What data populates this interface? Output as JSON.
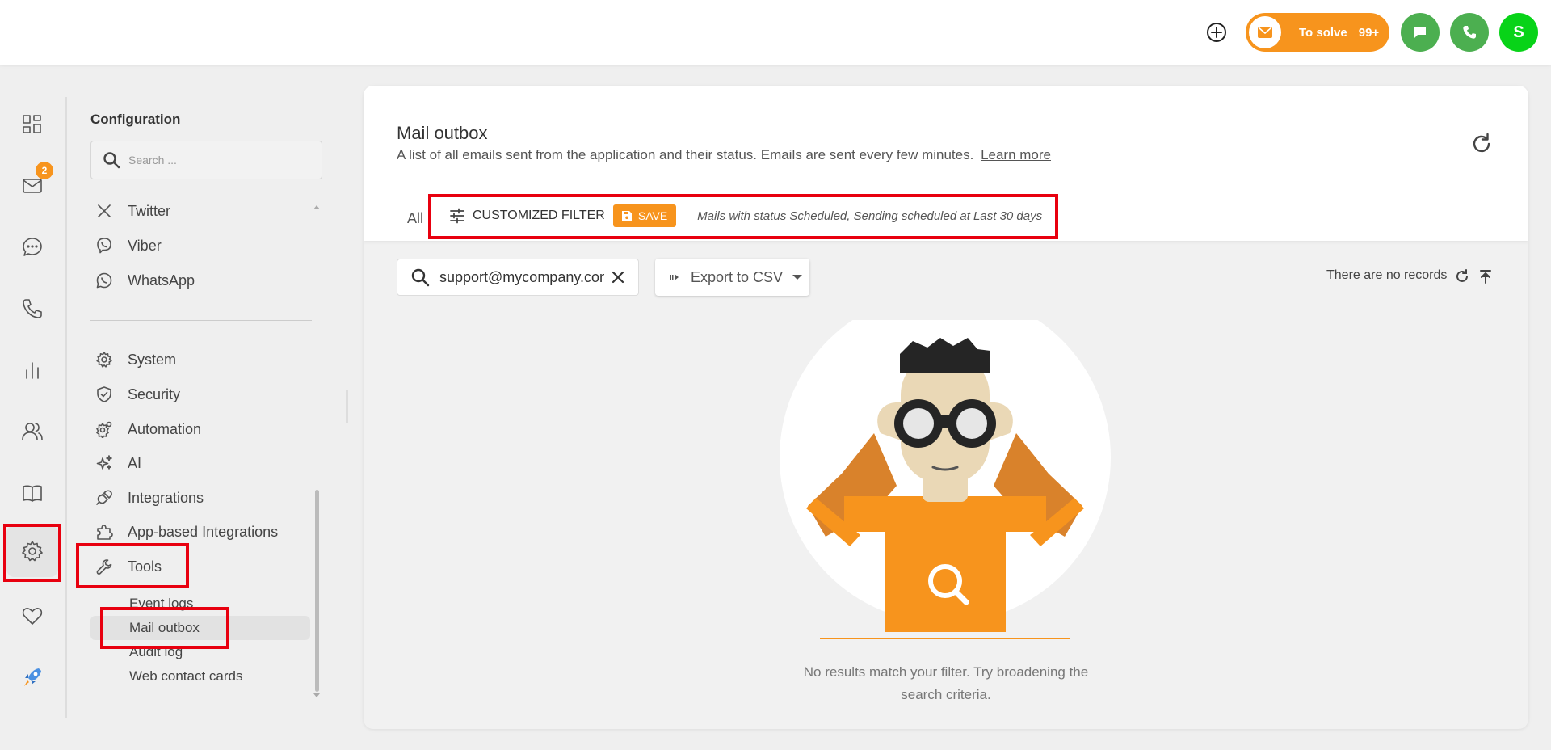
{
  "topbar": {
    "to_solve_label": "To solve",
    "to_solve_count": "99+",
    "avatar_initial": "S",
    "colors": {
      "orange": "#f7941d",
      "green": "#4caf50",
      "avatar_green": "#08d318"
    }
  },
  "rail": {
    "items": [
      {
        "name": "dashboard-icon"
      },
      {
        "name": "mail-icon",
        "badge": "2"
      },
      {
        "name": "chat-icon"
      },
      {
        "name": "phone-icon"
      },
      {
        "name": "reports-icon"
      },
      {
        "name": "contacts-icon"
      },
      {
        "name": "knowledge-base-icon"
      },
      {
        "name": "settings-icon",
        "active": true
      },
      {
        "name": "heart-icon"
      },
      {
        "name": "rocket-icon"
      }
    ]
  },
  "sidebar": {
    "title": "Configuration",
    "search_placeholder": "Search ...",
    "channels": [
      {
        "label": "Twitter",
        "icon": "x-icon"
      },
      {
        "label": "Viber",
        "icon": "viber-icon"
      },
      {
        "label": "WhatsApp",
        "icon": "whatsapp-icon"
      }
    ],
    "settings": [
      {
        "label": "System",
        "icon": "gear-icon"
      },
      {
        "label": "Security",
        "icon": "shield-icon"
      },
      {
        "label": "Automation",
        "icon": "automation-icon"
      },
      {
        "label": "AI",
        "icon": "sparkle-icon"
      },
      {
        "label": "Integrations",
        "icon": "plug-icon"
      },
      {
        "label": "App-based Integrations",
        "icon": "puzzle-icon"
      },
      {
        "label": "Tools",
        "icon": "wrench-icon"
      }
    ],
    "tools_sub": [
      {
        "label": "Event logs"
      },
      {
        "label": "Mail outbox",
        "active": true
      },
      {
        "label": "Audit log"
      },
      {
        "label": "Web contact cards"
      }
    ]
  },
  "main": {
    "title": "Mail outbox",
    "description": "A list of all emails sent from the application and their status. Emails are sent every few minutes.",
    "learn_more": "Learn more",
    "tab_all": "All",
    "filter_label": "CUSTOMIZED FILTER",
    "save_label": "SAVE",
    "filter_description": "Mails with status Scheduled, Sending scheduled at Last 30 days",
    "search_value": "support@mycompany.com",
    "export_label": "Export to CSV",
    "no_records": "There are no records",
    "empty_message": "No results match your filter. Try broadening the search criteria."
  }
}
